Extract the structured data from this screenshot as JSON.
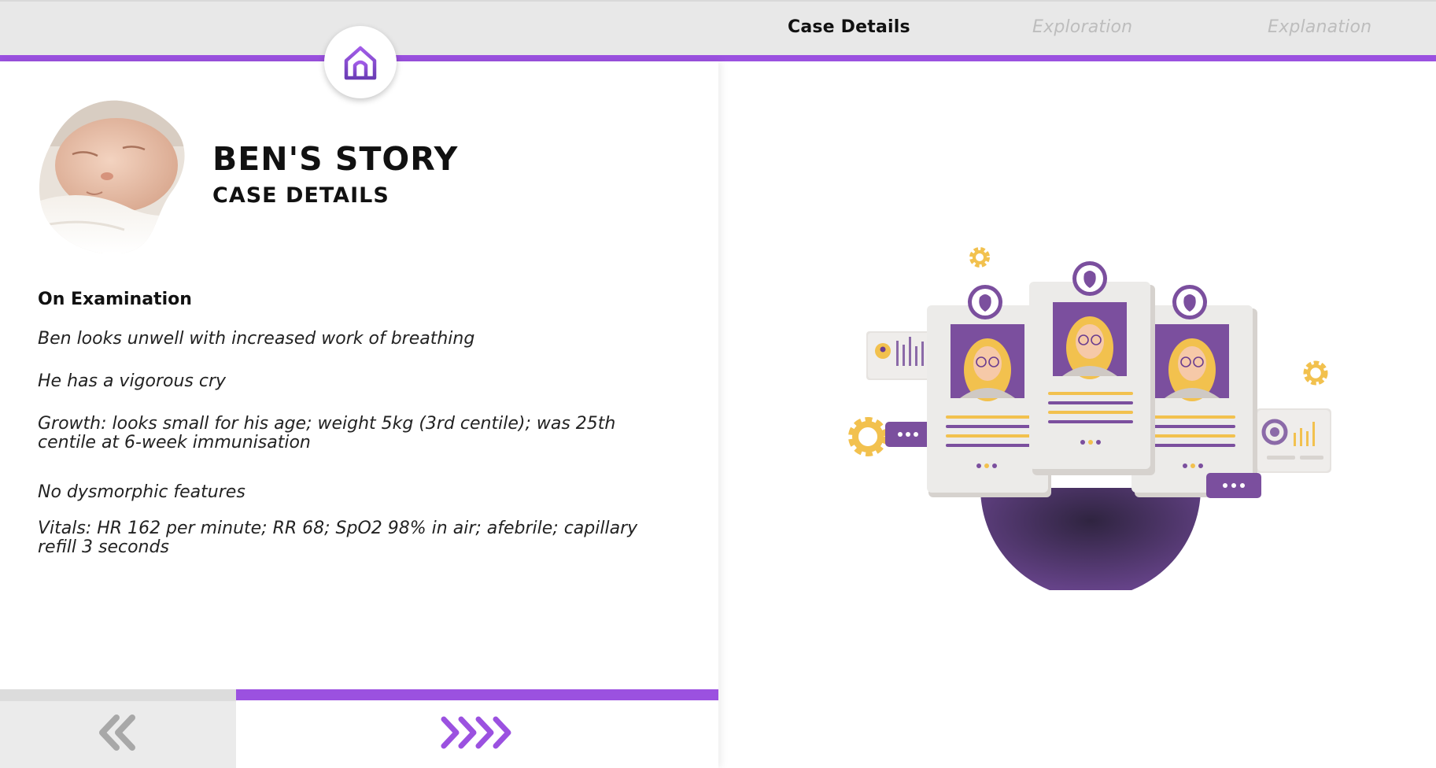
{
  "nav": {
    "tabs": [
      {
        "label": "Case Details",
        "active": true
      },
      {
        "label": "Exploration",
        "active": false
      },
      {
        "label": "Explanation",
        "active": false
      }
    ],
    "home_icon": "home-icon"
  },
  "story": {
    "title": "BEN'S STORY",
    "subtitle": "CASE DETAILS"
  },
  "examination": {
    "heading": "On Examination",
    "lines": [
      "Ben looks unwell with increased work of breathing",
      "He has a vigorous cry",
      "Growth: looks small for his age; weight 5kg (3rd centile); was 25th centile at 6-week immunisation",
      "No dysmorphic features",
      "Vitals: HR 162 per minute; RR 68; SpO2 98% in air; afebrile; capillary refill 3 seconds"
    ]
  },
  "footer": {
    "prev_icon": "double-chevron-left-icon",
    "next_icon": "quadruple-chevron-right-icon"
  },
  "colors": {
    "accent": "#9b51e0",
    "dark_purple": "#6b3d8f",
    "yellow": "#f2c14e"
  }
}
